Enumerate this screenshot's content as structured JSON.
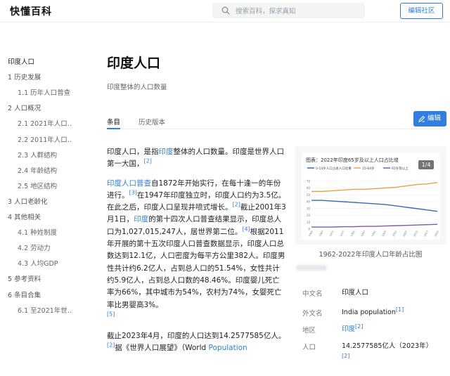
{
  "header": {
    "logo": "快懂百科",
    "search_placeholder": "搜索百科，探求真知",
    "edit_community": "编辑社区"
  },
  "toc": [
    {
      "label": "印度人口",
      "level": "top"
    },
    {
      "label": "1 历史发展",
      "level": "l1"
    },
    {
      "label": "1.1 历年人口普查",
      "level": "l2"
    },
    {
      "label": "2 人口概况",
      "level": "l1"
    },
    {
      "label": "2.1 2021年人口…",
      "level": "l2"
    },
    {
      "label": "2.2 2011年人口…",
      "level": "l2"
    },
    {
      "label": "2.3 人群结构",
      "level": "l2"
    },
    {
      "label": "2.4 年龄结构",
      "level": "l2"
    },
    {
      "label": "2.5 地区结构",
      "level": "l2"
    },
    {
      "label": "3 人口老龄化",
      "level": "l1"
    },
    {
      "label": "4 其他相关",
      "level": "l1"
    },
    {
      "label": "4.1 种姓制度",
      "level": "l2"
    },
    {
      "label": "4.2 劳动力",
      "level": "l2"
    },
    {
      "label": "4.3 人均GDP",
      "level": "l2"
    },
    {
      "label": "5 参考资料",
      "level": "l1"
    },
    {
      "label": "6 条目合集",
      "level": "l1"
    },
    {
      "label": "6.1 至2021年世…",
      "level": "l2"
    }
  ],
  "page": {
    "title": "印度人口",
    "subtitle": "印度整体的人口数量",
    "tabs": [
      "条目",
      "历史版本"
    ],
    "edit_button": "编辑"
  },
  "article": {
    "p1": {
      "t1": "印度人口，是指",
      "link1": "印度",
      "t2": "整体的人口数量。印度是世界人口第一大国，",
      "ref1": "[2]"
    },
    "p2": {
      "link1": "印度人口普查",
      "t1": "自1872年开始实行，在每十逢一的年份进行。",
      "ref1": "[3]",
      "t2": "在1947年印度独立时，印度人口约为3.5亿。在此之后，印度人口呈现井喷式增长。",
      "ref2": "[2]",
      "t3": "截止2001年3月1日，",
      "link2": "印度",
      "t4": "的第十四次人口普查结果显示，印度总人口为1,027,015,247人，居世界第二位。",
      "ref3": "[4]",
      "t5": "根据2011年开展的第十五次印度人口普查数据显示，印度人口总数达到12.1亿，人口密度为每平方公里382人。印度男性共计约6.2亿人，占到总人口的51.54%，女性共计约5.9亿人，占到总人口数的48.46%。印度婴儿死亡率为66%，其中城市为54%，农村为74%，女婴死亡率比男婴高3%。",
      "ref4": "[5]"
    },
    "p3": {
      "t1": "截止2023年4月，印度的人口达到14.2577585亿人。",
      "ref1": "[2]",
      "t2": "据《世界人口展望》（World ",
      "link1": "Population"
    }
  },
  "figure": {
    "counter": "1/4",
    "caption": "1962-2022年印度人口年龄占比图"
  },
  "chart_data": {
    "type": "line",
    "title": "图表：2022年印度65岁及以上人口占比增",
    "legend": [
      "0-14岁人口占总人口比重",
      "15-64岁",
      "65岁及以上"
    ],
    "x": [
      1962,
      1967,
      1972,
      1977,
      1982,
      1987,
      1992,
      1997,
      2002,
      2007,
      2012,
      2017,
      2022
    ],
    "series": [
      {
        "name": "0-14岁人口占总人口比重",
        "values": [
          42,
          42,
          41,
          40,
          39,
          38,
          37,
          36,
          34,
          32,
          30,
          28,
          26
        ],
        "color": "#3a67b8"
      },
      {
        "name": "15-64岁",
        "values": [
          55,
          55,
          56,
          57,
          58,
          58,
          59,
          60,
          61,
          63,
          65,
          66,
          68
        ],
        "color": "#e8a34a"
      },
      {
        "name": "65岁及以上",
        "values": [
          3,
          3,
          3,
          3.5,
          3.5,
          4,
          4,
          4.5,
          5,
          5.5,
          6,
          6.5,
          7
        ],
        "color": "#7b5aa6"
      }
    ],
    "ylim": [
      0,
      80
    ],
    "yticks": [
      0,
      10,
      20,
      30,
      40,
      50,
      60,
      70
    ]
  },
  "infobox": [
    {
      "key": "中文名",
      "value": "印度人口",
      "ref": "",
      "is_link": false
    },
    {
      "key": "外文名",
      "value": "India population",
      "ref": "[1]",
      "is_link": false
    },
    {
      "key": "地区",
      "value": "印度",
      "ref": "[2]",
      "is_link": true
    },
    {
      "key": "人口",
      "value": "14.2577585亿人（2023年）",
      "ref": "[2]",
      "is_link": false
    }
  ]
}
